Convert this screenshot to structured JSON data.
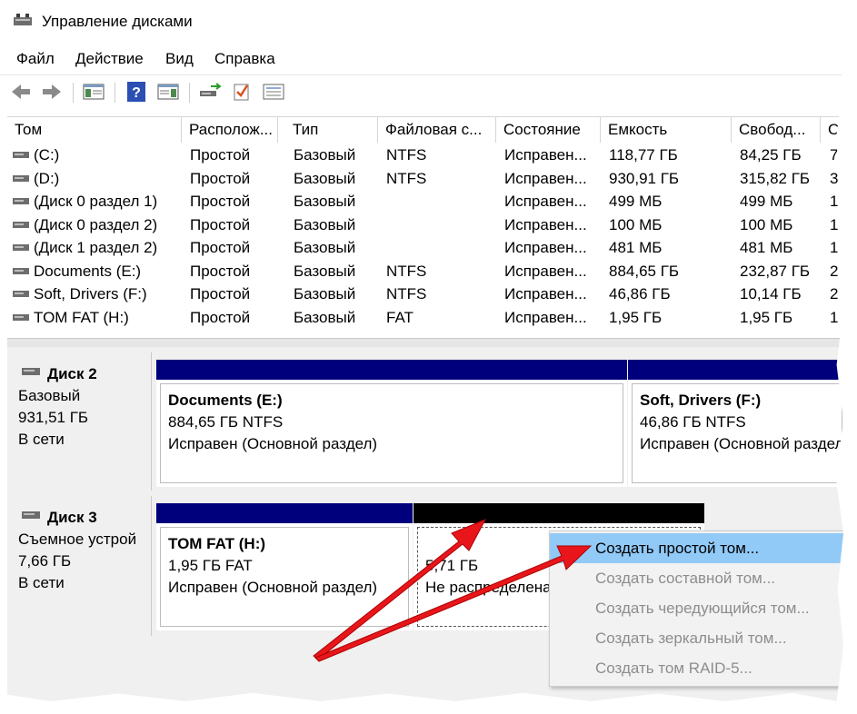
{
  "window": {
    "title": "Управление дисками"
  },
  "menu": [
    "Файл",
    "Действие",
    "Вид",
    "Справка"
  ],
  "toolbar": [
    "back-icon",
    "forward-icon",
    "console-tree-icon",
    "help-icon",
    "action-pane-icon",
    "connect-icon",
    "properties-icon",
    "list-icon"
  ],
  "columns": [
    "Том",
    "Располож...",
    "Тип",
    "Файловая с...",
    "Состояние",
    "Емкость",
    "Свобод...",
    "С"
  ],
  "volumes": [
    {
      "name": "(C:)",
      "layout": "Простой",
      "type": "Базовый",
      "fs": "NTFS",
      "status": "Исправен...",
      "capacity": "118,77 ГБ",
      "free": "84,25 ГБ",
      "extra": "7"
    },
    {
      "name": "(D:)",
      "layout": "Простой",
      "type": "Базовый",
      "fs": "NTFS",
      "status": "Исправен...",
      "capacity": "930,91 ГБ",
      "free": "315,82 ГБ",
      "extra": "3"
    },
    {
      "name": "(Диск 0 раздел 1)",
      "layout": "Простой",
      "type": "Базовый",
      "fs": "",
      "status": "Исправен...",
      "capacity": "499 МБ",
      "free": "499 МБ",
      "extra": "1"
    },
    {
      "name": "(Диск 0 раздел 2)",
      "layout": "Простой",
      "type": "Базовый",
      "fs": "",
      "status": "Исправен...",
      "capacity": "100 МБ",
      "free": "100 МБ",
      "extra": "1"
    },
    {
      "name": "(Диск 1 раздел 2)",
      "layout": "Простой",
      "type": "Базовый",
      "fs": "",
      "status": "Исправен...",
      "capacity": "481 МБ",
      "free": "481 МБ",
      "extra": "1"
    },
    {
      "name": "Documents (E:)",
      "layout": "Простой",
      "type": "Базовый",
      "fs": "NTFS",
      "status": "Исправен...",
      "capacity": "884,65 ГБ",
      "free": "232,87 ГБ",
      "extra": "2"
    },
    {
      "name": "Soft, Drivers (F:)",
      "layout": "Простой",
      "type": "Базовый",
      "fs": "NTFS",
      "status": "Исправен...",
      "capacity": "46,86 ГБ",
      "free": "10,14 ГБ",
      "extra": "2"
    },
    {
      "name": "TOM FAT (H:)",
      "layout": "Простой",
      "type": "Базовый",
      "fs": "FAT",
      "status": "Исправен...",
      "capacity": "1,95 ГБ",
      "free": "1,95 ГБ",
      "extra": "1"
    }
  ],
  "disk2": {
    "name": "Диск 2",
    "type": "Базовый",
    "size": "931,51 ГБ",
    "state": "В сети",
    "parts": [
      {
        "title": "Documents  (E:)",
        "size": "884,65 ГБ NTFS",
        "status": "Исправен (Основной раздел)"
      },
      {
        "title": "Soft, Drivers  (F:)",
        "size": "46,86 ГБ NTFS",
        "status": "Исправен (Основной раздел)"
      }
    ]
  },
  "disk3": {
    "name": "Диск 3",
    "type": "Съемное устрой",
    "size": "7,66 ГБ",
    "state": "В сети",
    "parts": [
      {
        "title": "TOM FAT  (H:)",
        "size": "1,95 ГБ FAT",
        "status": "Исправен (Основной раздел)"
      },
      {
        "size": "5,71 ГБ",
        "status": "Не распределена"
      }
    ]
  },
  "context_menu": [
    "Создать простой том...",
    "Создать составной том...",
    "Создать чередующийся том...",
    "Создать зеркальный том...",
    "Создать том RAID-5..."
  ],
  "colors": {
    "primary_bar": "#00007c",
    "unallocated_bar": "#000000",
    "highlight": "#91c9f7",
    "arrow": "#e8161b"
  }
}
